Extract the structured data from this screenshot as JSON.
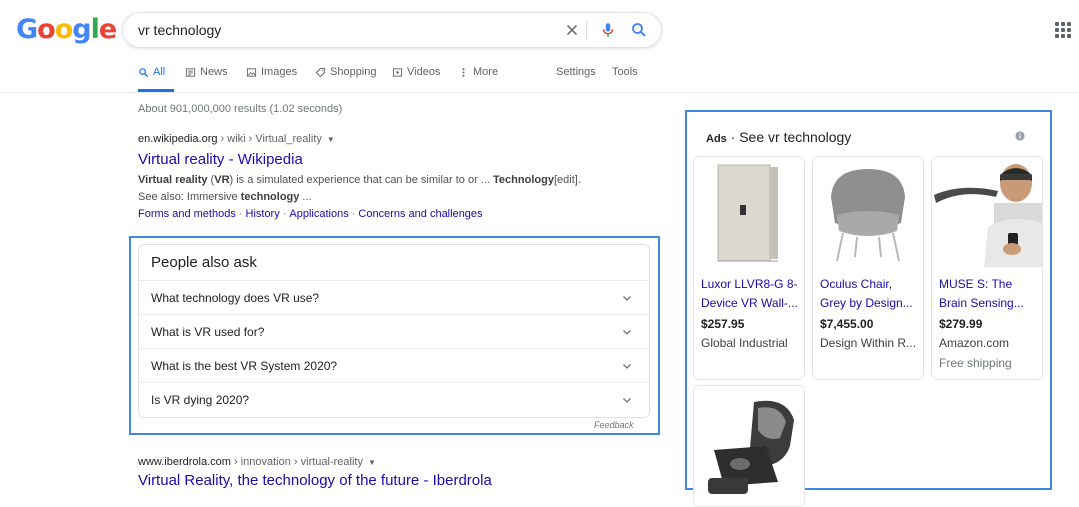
{
  "logo": {
    "letters": [
      "G",
      "o",
      "o",
      "g",
      "l",
      "e"
    ],
    "colors": [
      "#4285f4",
      "#ea4335",
      "#fbbc05",
      "#4285f4",
      "#34a853",
      "#ea4335"
    ]
  },
  "search": {
    "query": "vr technology",
    "clear_icon": "close-icon",
    "mic_icon": "microphone-icon",
    "search_icon": "search-icon"
  },
  "apps_icon": "grid-apps-icon",
  "tabs": [
    {
      "label": "All",
      "icon": "search-icon"
    },
    {
      "label": "News",
      "icon": "news-icon"
    },
    {
      "label": "Images",
      "icon": "image-icon"
    },
    {
      "label": "Shopping",
      "icon": "tag-icon"
    },
    {
      "label": "Videos",
      "icon": "play-icon"
    },
    {
      "label": "More",
      "icon": "more-vert-icon"
    },
    {
      "label": "Settings"
    },
    {
      "label": "Tools"
    }
  ],
  "result_stats": "About 901,000,000 results (1.02 seconds)",
  "result1": {
    "domain": "en.wikipedia.org",
    "path": " › wiki › Virtual_reality",
    "title": "Virtual reality - Wikipedia",
    "snippet_parts": [
      {
        "b": "Virtual reality"
      },
      {
        "t": " ("
      },
      {
        "b": "VR"
      },
      {
        "t": ") is a simulated experience that can be similar to or ... "
      },
      {
        "b": "Technology"
      },
      {
        "t": "[edit]. See also: Immersive "
      },
      {
        "b": "technology"
      },
      {
        "t": " ..."
      }
    ],
    "sitelinks": [
      "Forms and methods",
      "History",
      "Applications",
      "Concerns and challenges"
    ]
  },
  "paa": {
    "heading": "People also ask",
    "questions": [
      "What technology does VR use?",
      "What is VR used for?",
      "What is the best VR System 2020?",
      "Is VR dying 2020?"
    ],
    "feedback": "Feedback"
  },
  "result2": {
    "domain": "www.iberdrola.com",
    "path": " › innovation › virtual-reality",
    "title": "Virtual Reality, the technology of the future - Iberdrola"
  },
  "ads": {
    "ads_word": "Ads",
    "label": " · See vr technology",
    "products": [
      {
        "title": "Luxor LLVR8-G 8-Device VR Wall-...",
        "price": "$257.95",
        "store": "Global Industrial",
        "shipping": ""
      },
      {
        "title": "Oculus Chair, Grey by Design...",
        "price": "$7,455.00",
        "store": "Design Within R...",
        "shipping": ""
      },
      {
        "title": "MUSE S: The Brain Sensing...",
        "price": "$279.99",
        "store": "Amazon.com",
        "shipping": "Free shipping"
      },
      {
        "title": "",
        "price": "",
        "store": "",
        "shipping": ""
      }
    ]
  },
  "colors": {
    "link": "#1a0dab",
    "accent": "#1a73e8",
    "highlight": "#3f86e0"
  }
}
